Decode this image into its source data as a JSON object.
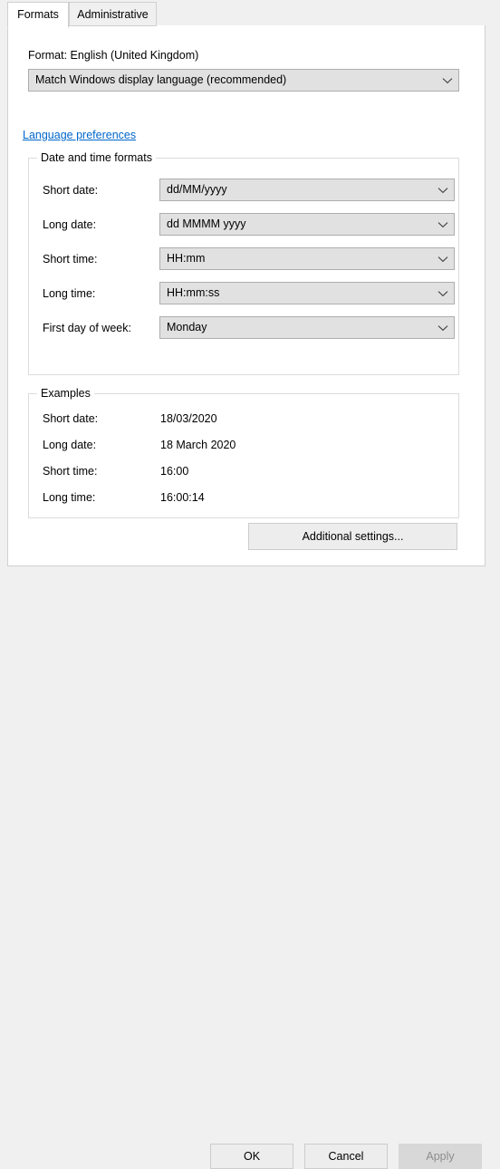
{
  "window": {
    "tabs": [
      {
        "label": "Formats",
        "selected": true
      },
      {
        "label": "Administrative",
        "selected": false
      }
    ]
  },
  "format_section": {
    "format_line": "Format: English (United Kingdom)",
    "language_combo_value": "Match Windows display language (recommended)",
    "language_preferences_link": "Language preferences"
  },
  "datetime_group": {
    "title": "Date and time formats",
    "rows": [
      {
        "label": "Short date:",
        "value": "dd/MM/yyyy"
      },
      {
        "label": "Long date:",
        "value": "dd MMMM yyyy"
      },
      {
        "label": "Short time:",
        "value": "HH:mm"
      },
      {
        "label": "Long time:",
        "value": "HH:mm:ss"
      },
      {
        "label": "First day of week:",
        "value": "Monday"
      }
    ]
  },
  "examples_group": {
    "title": "Examples",
    "rows": [
      {
        "label": "Short date:",
        "value": "18/03/2020"
      },
      {
        "label": "Long date:",
        "value": "18 March 2020"
      },
      {
        "label": "Short time:",
        "value": "16:00"
      },
      {
        "label": "Long time:",
        "value": "16:00:14"
      }
    ]
  },
  "buttons": {
    "additional_settings": "Additional settings...",
    "ok": "OK",
    "cancel": "Cancel",
    "apply": "Apply",
    "apply_enabled": false
  },
  "colors": {
    "panel_background": "#ffffff",
    "dialog_background": "#f0f0f0",
    "control_face": "#e1e1e1",
    "control_border": "#adadad",
    "group_border": "#dcdcdc",
    "link": "#0066cc",
    "disabled_text": "#8d8d8d"
  },
  "icons": {
    "chevron_down": "chevron-down-icon"
  }
}
